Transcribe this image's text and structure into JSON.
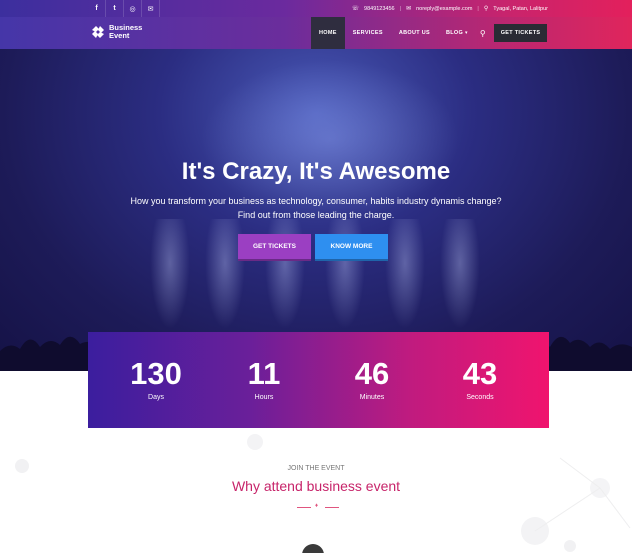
{
  "topbar": {
    "social": [
      {
        "icon": "facebook-icon",
        "glyph": "f"
      },
      {
        "icon": "twitter-icon",
        "glyph": "t"
      },
      {
        "icon": "instagram-icon",
        "glyph": "◎"
      },
      {
        "icon": "mail-icon",
        "glyph": "✉"
      }
    ],
    "phone": "9849123456",
    "email": "noreply@example.com",
    "address": "Tyagal, Patan, Lalitpur"
  },
  "nav": {
    "logo_line1": "Business",
    "logo_line2": "Event",
    "items": [
      "HOME",
      "SERVICES",
      "ABOUT US",
      "BLOG"
    ],
    "active": "HOME",
    "cta": "GET TICKETS"
  },
  "hero": {
    "title": "It's Crazy, It's Awesome",
    "subtitle_line1": "How you transform your business as technology, consumer, habits industry dynamis change?",
    "subtitle_line2": "Find out from those leading the charge.",
    "btn_primary": "GET TICKETS",
    "btn_secondary": "KNOW MORE"
  },
  "countdown": [
    {
      "value": "130",
      "label": "Days"
    },
    {
      "value": "11",
      "label": "Hours"
    },
    {
      "value": "46",
      "label": "Minutes"
    },
    {
      "value": "43",
      "label": "Seconds"
    }
  ],
  "about": {
    "kicker": "JOIN THE EVENT",
    "title": "Why attend business event"
  },
  "colors": {
    "accent_pink": "#e0255c",
    "accent_purple": "#6b2d9c",
    "btn_purple": "#9b3fc2",
    "btn_blue": "#2e8ff0",
    "title_pink": "#c7246a"
  }
}
